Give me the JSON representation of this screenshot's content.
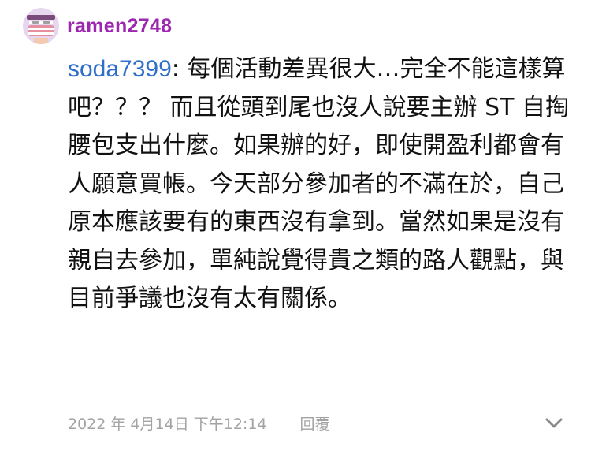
{
  "comment": {
    "author": "ramen2748",
    "avatar_icon": "mask-face-icon",
    "mention": "soda7399",
    "body_text": ": 每個活動差異很大…完全不能這樣算吧？？？\n而且從頭到尾也沒人說要主辦 ST 自掏腰包支出什麼。如果辦的好，即使開盈利都會有人願意買帳。今天部分參加者的不滿在於，自己原本應該要有的東西沒有拿到。當然如果是沒有親自去參加，單純說覺得貴之類的路人觀點，與目前爭議也沒有太有關係。",
    "timestamp": "2022 年 4月14日 下午12:14",
    "reply_label": "回覆",
    "expand_icon": "chevron-down-icon"
  },
  "colors": {
    "author": "#9c27b0",
    "mention": "#2f6fc9",
    "body": "#111111",
    "meta": "#a3a3a3"
  }
}
